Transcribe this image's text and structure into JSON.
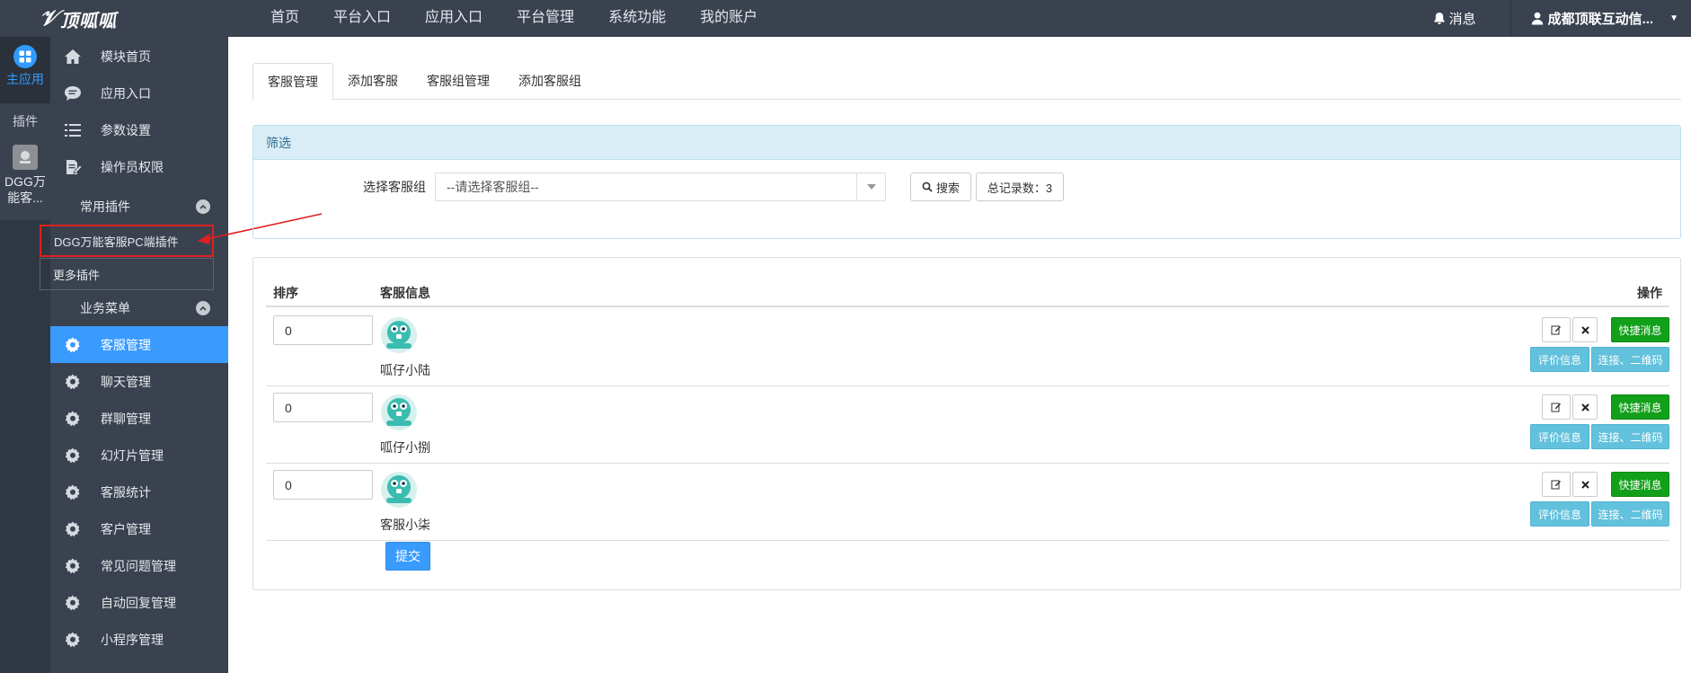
{
  "topbar": {
    "logo": "顶呱呱",
    "nav": [
      "首页",
      "平台入口",
      "应用入口",
      "平台管理",
      "系统功能",
      "我的账户"
    ],
    "messages": "消息",
    "account": "成都顶联互动信..."
  },
  "rail": {
    "main": "主应用",
    "plugin": "插件",
    "dgg_line1": "DGG万",
    "dgg_line2": "能客..."
  },
  "sidebar": {
    "top_items": [
      "模块首页",
      "应用入口",
      "参数设置",
      "操作员权限"
    ],
    "group_common": "常用插件",
    "plugins": [
      "DGG万能客服PC端插件",
      "更多插件"
    ],
    "group_business": "业务菜单",
    "business_items": [
      "客服管理",
      "聊天管理",
      "群聊管理",
      "幻灯片管理",
      "客服统计",
      "客户管理",
      "常见问题管理",
      "自动回复管理",
      "小程序管理"
    ]
  },
  "colors": {
    "topbar": "#3a4250",
    "accent": "#3a9bff",
    "success": "#12a01a",
    "info": "#62c1dc",
    "highlight": "#e02020"
  },
  "tabs": [
    "客服管理",
    "添加客服",
    "客服组管理",
    "添加客服组"
  ],
  "filter": {
    "title": "筛选",
    "label": "选择客服组",
    "select_value": "--请选择客服组--",
    "search": "搜索",
    "total": "总记录数：3"
  },
  "table": {
    "headers": [
      "排序",
      "客服信息",
      "操作"
    ],
    "rows": [
      {
        "order": "0",
        "name": "呱仔小陆"
      },
      {
        "order": "0",
        "name": "呱仔小捌"
      },
      {
        "order": "0",
        "name": "客服小柒"
      }
    ],
    "quick_msg": "快捷消息",
    "rate_info": "评价信息",
    "link_qr": "连接、二维码",
    "submit": "提交"
  }
}
